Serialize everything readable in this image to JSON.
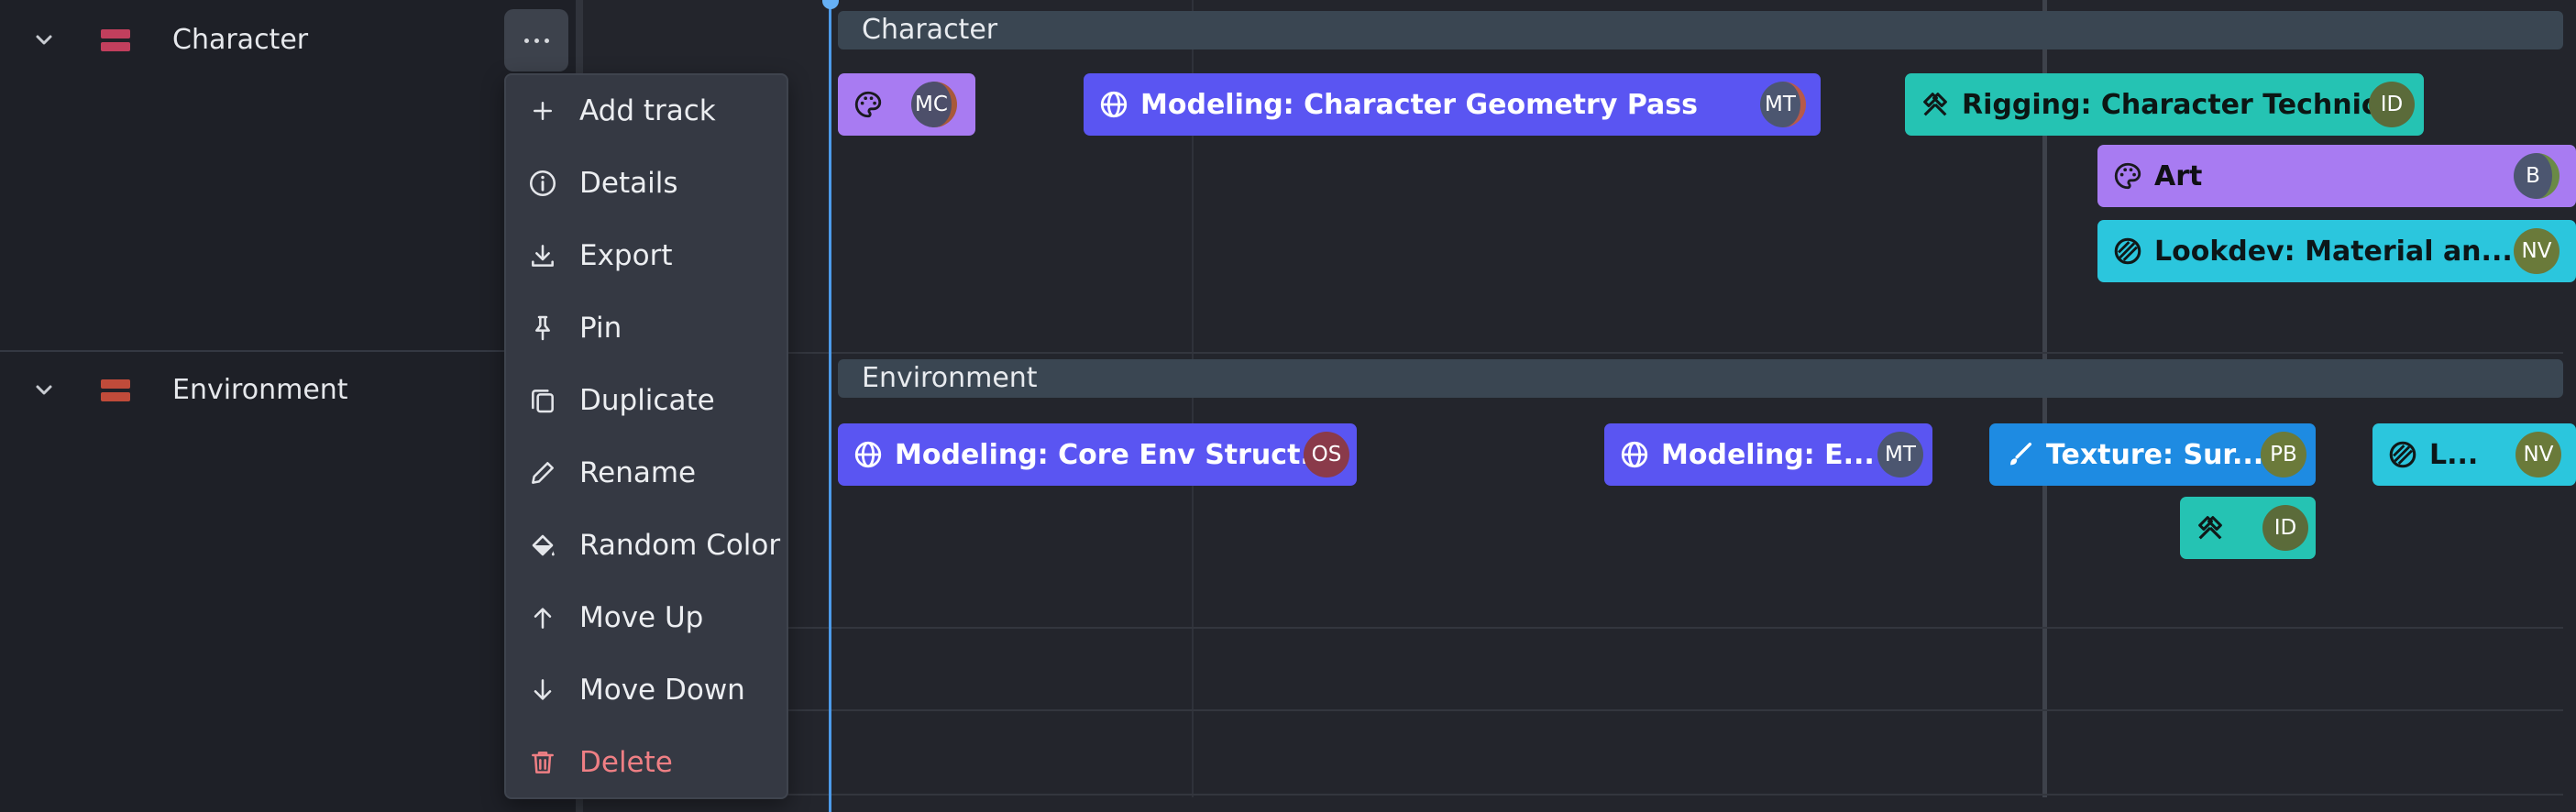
{
  "tracks": [
    {
      "name": "Character",
      "color": "#c13f5d"
    },
    {
      "name": "Environment",
      "color": "#c04b3a"
    }
  ],
  "menu": {
    "items": [
      {
        "label": "Add track",
        "icon": "plus-icon"
      },
      {
        "label": "Details",
        "icon": "info-icon"
      },
      {
        "label": "Export",
        "icon": "download-icon"
      },
      {
        "label": "Pin",
        "icon": "pin-icon"
      },
      {
        "label": "Duplicate",
        "icon": "copy-icon"
      },
      {
        "label": "Rename",
        "icon": "pencil-icon"
      },
      {
        "label": "Random Color",
        "icon": "paint-bucket-icon"
      },
      {
        "label": "Move Up",
        "icon": "arrow-up-icon"
      },
      {
        "label": "Move Down",
        "icon": "arrow-down-icon"
      },
      {
        "label": "Delete",
        "icon": "trash-icon",
        "danger": true
      }
    ]
  },
  "timeline": {
    "groups": [
      {
        "title": "Character",
        "clips": [
          {
            "label": "",
            "icon": "palette-icon",
            "color": "purple",
            "avatars": [
              "MC"
            ]
          },
          {
            "label": "Modeling: Character Geometry Pass",
            "icon": "globe-icon",
            "color": "indigo",
            "avatars": [
              "MT"
            ]
          },
          {
            "label": "Rigging: Character Technic...",
            "icon": "hammer-icon",
            "color": "teal",
            "avatars": [
              "ID"
            ]
          },
          {
            "label": "Art",
            "icon": "palette-icon",
            "color": "purple",
            "avatars": [
              "B"
            ]
          },
          {
            "label": "Lookdev: Material an...",
            "icon": "sphere-icon",
            "color": "cyan",
            "avatars": [
              "NV"
            ]
          }
        ]
      },
      {
        "title": "Environment",
        "clips": [
          {
            "label": "Modeling: Core Env Struct...",
            "icon": "globe-icon",
            "color": "indigo",
            "avatars": [
              "OS"
            ]
          },
          {
            "label": "Modeling: E...",
            "icon": "globe-icon",
            "color": "indigo",
            "avatars": [
              "MT"
            ]
          },
          {
            "label": "Texture: Sur...",
            "icon": "brush-icon",
            "color": "blue",
            "avatars": [
              "PB"
            ]
          },
          {
            "label": "L...",
            "icon": "sphere-icon",
            "color": "cyan",
            "avatars": [
              "NV"
            ]
          },
          {
            "label": "",
            "icon": "hammer-icon",
            "color": "teal",
            "avatars": [
              "ID"
            ]
          }
        ]
      }
    ]
  }
}
